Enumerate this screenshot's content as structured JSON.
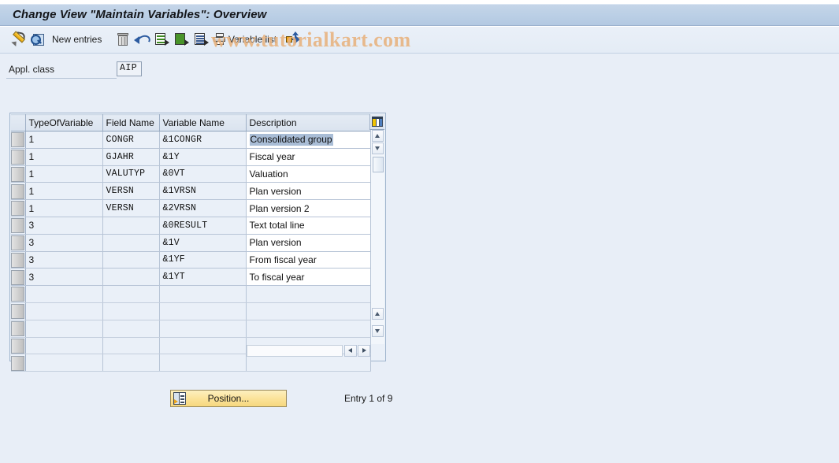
{
  "window": {
    "title": "Change View \"Maintain Variables\": Overview"
  },
  "watermark": {
    "text": "www.tutorialkart.com",
    "color": "#e8b27e"
  },
  "toolbar": {
    "items": [
      {
        "name": "display-change-toggle",
        "icon": "pencil-icon",
        "label": ""
      },
      {
        "name": "display-details",
        "icon": "magnifier-document-icon",
        "label": ""
      },
      {
        "name": "new-entries",
        "icon": "",
        "label": "New entries"
      },
      {
        "name": "delete",
        "icon": "trash-icon",
        "label": ""
      },
      {
        "name": "undo",
        "icon": "undo-arrow-icon",
        "label": ""
      },
      {
        "name": "copy-as",
        "icon": "document-green-arrow-icon",
        "label": ""
      },
      {
        "name": "select-all",
        "icon": "document-green-filled-icon",
        "label": ""
      },
      {
        "name": "select-block",
        "icon": "document-lines-arrow-icon",
        "label": ""
      },
      {
        "name": "variable-list",
        "icon": "printer-icon",
        "label": "Variable list"
      },
      {
        "name": "expand",
        "icon": "expand-arrows-icon",
        "label": ""
      }
    ]
  },
  "form": {
    "appl_class_label": "Appl. class",
    "appl_class_value": "AIP"
  },
  "table": {
    "columns": [
      "TypeOfVariable",
      "Field Name",
      "Variable Name",
      "Description"
    ],
    "rows": [
      {
        "type": "1",
        "field": "CONGR",
        "variable": "&1CONGR",
        "description": "Consolidated group",
        "selected": true
      },
      {
        "type": "1",
        "field": "GJAHR",
        "variable": "&1Y",
        "description": "Fiscal year",
        "selected": false
      },
      {
        "type": "1",
        "field": "VALUTYP",
        "variable": "&0VT",
        "description": "Valuation",
        "selected": false
      },
      {
        "type": "1",
        "field": "VERSN",
        "variable": "&1VRSN",
        "description": "Plan version",
        "selected": false
      },
      {
        "type": "1",
        "field": "VERSN",
        "variable": "&2VRSN",
        "description": "Plan version 2",
        "selected": false
      },
      {
        "type": "3",
        "field": "",
        "variable": "&0RESULT",
        "description": "Text total line",
        "selected": false
      },
      {
        "type": "3",
        "field": "",
        "variable": "&1V",
        "description": "Plan version",
        "selected": false
      },
      {
        "type": "3",
        "field": "",
        "variable": "&1YF",
        "description": "From fiscal year",
        "selected": false
      },
      {
        "type": "3",
        "field": "",
        "variable": "&1YT",
        "description": "To fiscal year",
        "selected": false
      },
      {
        "type": "",
        "field": "",
        "variable": "",
        "description": "",
        "selected": false
      },
      {
        "type": "",
        "field": "",
        "variable": "",
        "description": "",
        "selected": false
      },
      {
        "type": "",
        "field": "",
        "variable": "",
        "description": "",
        "selected": false
      },
      {
        "type": "",
        "field": "",
        "variable": "",
        "description": "",
        "selected": false
      },
      {
        "type": "",
        "field": "",
        "variable": "",
        "description": "",
        "selected": false
      }
    ],
    "data_row_count": 9
  },
  "footer": {
    "position_label": "Position...",
    "entry_counter": "Entry 1 of 9"
  }
}
